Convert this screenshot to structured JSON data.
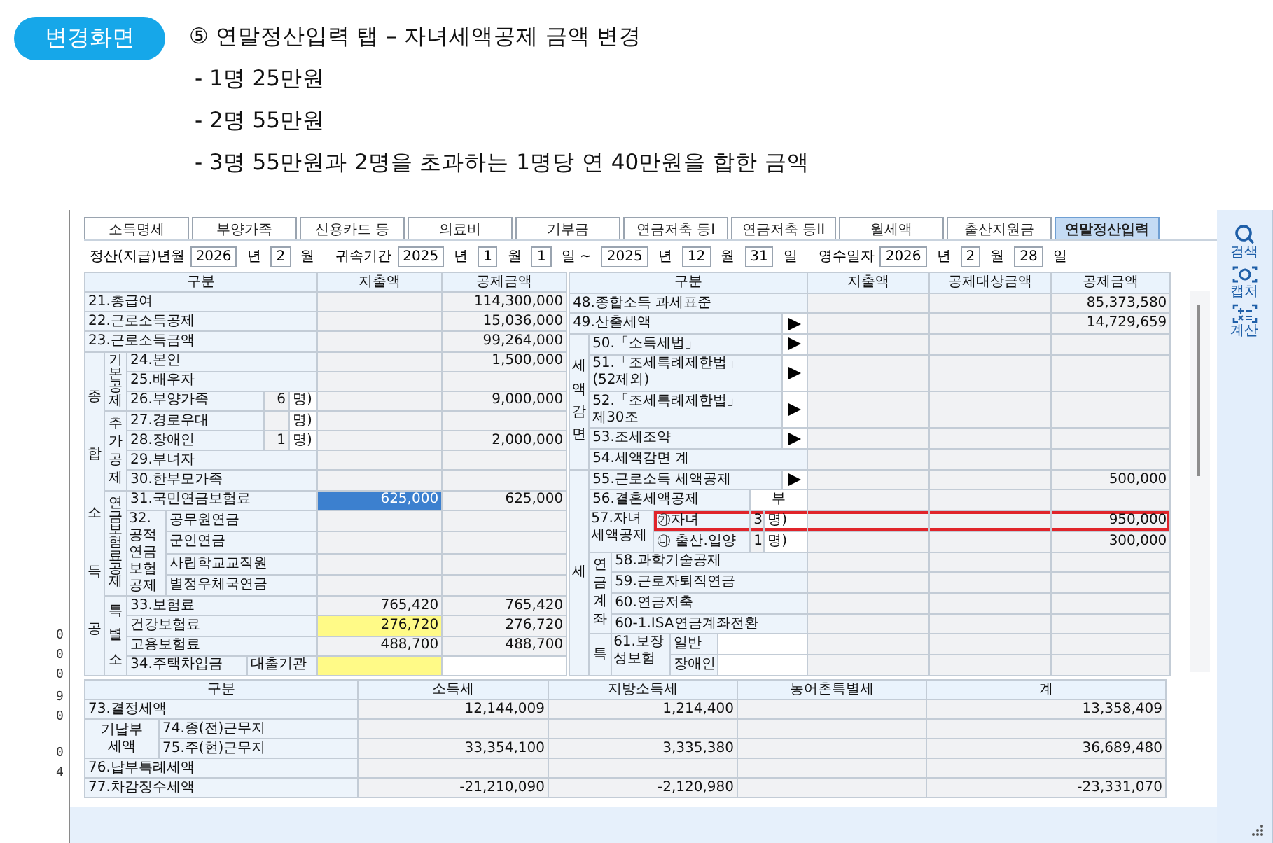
{
  "header": {
    "badge": "변경화면",
    "lines": [
      "⑤ 연말정산입력 탭 – 자녀세액공제 금액 변경",
      "- 1명 25만원",
      "- 2명 55만원",
      "- 3명 55만원과 2명을 초과하는 1명당 연 40만원을 합한 금액"
    ]
  },
  "background_digits": [
    [
      "0",
      "0",
      "0"
    ],
    [
      "9",
      "0",
      "0",
      "4"
    ]
  ],
  "tabs": [
    {
      "label": "소득명세",
      "selected": false
    },
    {
      "label": "부양가족",
      "selected": false
    },
    {
      "label": "신용카드 등",
      "selected": false
    },
    {
      "label": "의료비",
      "selected": false
    },
    {
      "label": "기부금",
      "selected": false
    },
    {
      "label": "연금저축 등I",
      "selected": false
    },
    {
      "label": "연금저축 등II",
      "selected": false
    },
    {
      "label": "월세액",
      "selected": false
    },
    {
      "label": "출산지원금",
      "selected": false
    },
    {
      "label": "연말정산입력",
      "selected": true
    }
  ],
  "date_row": [
    {
      "kind": "label",
      "text": "정산(지급)년월"
    },
    {
      "kind": "field",
      "text": "2026"
    },
    {
      "kind": "unit",
      "text": "년"
    },
    {
      "kind": "field",
      "text": "2"
    },
    {
      "kind": "unit",
      "text": "월"
    },
    {
      "kind": "label",
      "text": "귀속기간"
    },
    {
      "kind": "field",
      "text": "2025"
    },
    {
      "kind": "unit",
      "text": "년"
    },
    {
      "kind": "field",
      "text": "1"
    },
    {
      "kind": "unit",
      "text": "월"
    },
    {
      "kind": "field",
      "text": "1"
    },
    {
      "kind": "unit",
      "text": "일 ~"
    },
    {
      "kind": "field",
      "text": "2025"
    },
    {
      "kind": "unit",
      "text": "년"
    },
    {
      "kind": "field",
      "text": "12"
    },
    {
      "kind": "unit",
      "text": "월"
    },
    {
      "kind": "field",
      "text": "31"
    },
    {
      "kind": "unit",
      "text": "일"
    },
    {
      "kind": "label",
      "text": "영수일자"
    },
    {
      "kind": "field",
      "text": "2026"
    },
    {
      "kind": "unit",
      "text": "년"
    },
    {
      "kind": "field",
      "text": "2"
    },
    {
      "kind": "unit",
      "text": "월"
    },
    {
      "kind": "field",
      "text": "28"
    },
    {
      "kind": "unit",
      "text": "일"
    }
  ],
  "left_table": {
    "rows": [
      {
        "cells": [
          {
            "text": "구분",
            "kind": "head",
            "colspan": 7
          },
          {
            "text": "지출액",
            "kind": "head"
          },
          {
            "text": "공제금액",
            "kind": "head"
          }
        ]
      },
      {
        "cells": [
          {
            "text": "21.총급여",
            "kind": "label",
            "colspan": 7
          },
          {
            "kind": "value"
          },
          {
            "text": "114,300,000",
            "kind": "value"
          }
        ]
      },
      {
        "cells": [
          {
            "text": "22.근로소득공제",
            "kind": "label",
            "colspan": 7
          },
          {
            "kind": "value"
          },
          {
            "text": "15,036,000",
            "kind": "value"
          }
        ]
      },
      {
        "cells": [
          {
            "text": "23.근로소득금액",
            "kind": "label",
            "colspan": 7
          },
          {
            "kind": "value"
          },
          {
            "text": "99,264,000",
            "kind": "value"
          }
        ]
      },
      {
        "cells": [
          {
            "text": "종합소득공",
            "kind": "vlabel",
            "rowspan": 16
          },
          {
            "text": "기본공제",
            "kind": "vlabel",
            "rowspan": 3
          },
          {
            "text": "24.본인",
            "kind": "label",
            "colspan": 5
          },
          {
            "kind": "value"
          },
          {
            "text": "1,500,000",
            "kind": "value"
          }
        ]
      },
      {
        "cells": [
          {
            "text": "25.배우자",
            "kind": "label",
            "colspan": 5
          },
          {
            "kind": "value"
          },
          {
            "kind": "value"
          }
        ]
      },
      {
        "cells": [
          {
            "text": "26.부양가족",
            "kind": "label",
            "colspan": 3
          },
          {
            "text": "6",
            "kind": "count"
          },
          {
            "text": "명)",
            "kind": "unit"
          },
          {
            "kind": "value"
          },
          {
            "text": "9,000,000",
            "kind": "value"
          }
        ]
      },
      {
        "cells": [
          {
            "text": "추가공제",
            "kind": "vlabel",
            "rowspan": 4
          },
          {
            "text": "27.경로우대",
            "kind": "label",
            "colspan": 3
          },
          {
            "kind": "count"
          },
          {
            "text": "명)",
            "kind": "unit"
          },
          {
            "kind": "value"
          },
          {
            "kind": "value"
          }
        ]
      },
      {
        "cells": [
          {
            "text": "28.장애인",
            "kind": "label",
            "colspan": 3
          },
          {
            "text": "1",
            "kind": "count"
          },
          {
            "text": "명)",
            "kind": "unit"
          },
          {
            "kind": "value"
          },
          {
            "text": "2,000,000",
            "kind": "value"
          }
        ]
      },
      {
        "cells": [
          {
            "text": "29.부녀자",
            "kind": "label",
            "colspan": 5
          },
          {
            "kind": "value"
          },
          {
            "kind": "value"
          }
        ]
      },
      {
        "cells": [
          {
            "text": "30.한부모가족",
            "kind": "label",
            "colspan": 5
          },
          {
            "kind": "value"
          },
          {
            "kind": "value"
          }
        ]
      },
      {
        "cells": [
          {
            "text": "연금보험료공제",
            "kind": "vlabel",
            "rowspan": 5
          },
          {
            "text": "31.국민연금보험료",
            "kind": "label",
            "colspan": 5
          },
          {
            "text": "625,000",
            "kind": "selected"
          },
          {
            "text": "625,000",
            "kind": "value"
          }
        ]
      },
      {
        "cells": [
          {
            "text": "32. 공적연금보험공제",
            "kind": "wlabel",
            "rowspan": 4
          },
          {
            "text": "공무원연금",
            "kind": "label",
            "colspan": 4
          },
          {
            "kind": "value"
          },
          {
            "kind": "value"
          }
        ]
      },
      {
        "cells": [
          {
            "text": "군인연금",
            "kind": "label",
            "colspan": 4
          },
          {
            "kind": "value"
          },
          {
            "kind": "value"
          }
        ]
      },
      {
        "cells": [
          {
            "text": "사립학교교직원",
            "kind": "label",
            "colspan": 4
          },
          {
            "kind": "value"
          },
          {
            "kind": "value"
          }
        ]
      },
      {
        "cells": [
          {
            "text": "별정우체국연금",
            "kind": "label",
            "colspan": 4
          },
          {
            "kind": "value"
          },
          {
            "kind": "value"
          }
        ]
      },
      {
        "cells": [
          {
            "text": "특별소",
            "kind": "vlabel",
            "rowspan": 4
          },
          {
            "text": "33.보험료",
            "kind": "label",
            "colspan": 5
          },
          {
            "text": "765,420",
            "kind": "value"
          },
          {
            "text": "765,420",
            "kind": "value"
          }
        ]
      },
      {
        "cells": [
          {
            "text": "건강보험료",
            "kind": "label",
            "colspan": 5
          },
          {
            "text": "276,720",
            "kind": "required"
          },
          {
            "text": "276,720",
            "kind": "value"
          }
        ]
      },
      {
        "cells": [
          {
            "text": "고용보험료",
            "kind": "label",
            "colspan": 5
          },
          {
            "text": "488,700",
            "kind": "value"
          },
          {
            "text": "488,700",
            "kind": "value"
          }
        ]
      },
      {
        "cells": [
          {
            "text": "34.주택차입금",
            "kind": "label",
            "colspan": 2
          },
          {
            "text": "대출기관",
            "kind": "label",
            "colspan": 3
          },
          {
            "kind": "required"
          },
          {
            "kind": "input"
          }
        ]
      }
    ]
  },
  "right_table": {
    "rows": [
      {
        "cells": [
          {
            "text": "구분",
            "kind": "head",
            "colspan": 9
          },
          {
            "text": "지출액",
            "kind": "head"
          },
          {
            "text": "공제대상금액",
            "kind": "head"
          },
          {
            "text": "공제금액",
            "kind": "head"
          }
        ]
      },
      {
        "cells": [
          {
            "text": "48.종합소득 과세표준",
            "kind": "label",
            "colspan": 9
          },
          {
            "kind": "value"
          },
          {
            "kind": "value"
          },
          {
            "text": "85,373,580",
            "kind": "value"
          }
        ]
      },
      {
        "cells": [
          {
            "text": "49.산출세액",
            "kind": "label",
            "colspan": 8
          },
          {
            "kind": "arrow"
          },
          {
            "kind": "value"
          },
          {
            "kind": "value"
          },
          {
            "text": "14,729,659",
            "kind": "value"
          }
        ]
      },
      {
        "cells": [
          {
            "text": "세액감면",
            "kind": "vlabel",
            "rowspan": 5
          },
          {
            "text": "50.「소득세법」",
            "kind": "label",
            "colspan": 7
          },
          {
            "kind": "arrow"
          },
          {
            "kind": "value"
          },
          {
            "kind": "value"
          },
          {
            "kind": "value"
          }
        ]
      },
      {
        "cells": [
          {
            "text": "51.「조세특례제한법」\n(52제외)",
            "kind": "label",
            "colspan": 7
          },
          {
            "kind": "arrow"
          },
          {
            "kind": "value"
          },
          {
            "kind": "value"
          },
          {
            "kind": "value"
          }
        ]
      },
      {
        "cells": [
          {
            "text": "52.「조세특례제한법」\n제30조",
            "kind": "label",
            "colspan": 7
          },
          {
            "kind": "arrow"
          },
          {
            "kind": "value"
          },
          {
            "kind": "value"
          },
          {
            "kind": "value"
          }
        ]
      },
      {
        "cells": [
          {
            "text": "53.조세조약",
            "kind": "label",
            "colspan": 7
          },
          {
            "kind": "arrow"
          },
          {
            "kind": "value"
          },
          {
            "kind": "value"
          },
          {
            "kind": "value"
          }
        ]
      },
      {
        "cells": [
          {
            "text": "54.세액감면 계",
            "kind": "label",
            "colspan": 8
          },
          {
            "kind": "value"
          },
          {
            "kind": "value"
          },
          {
            "kind": "value"
          }
        ]
      },
      {
        "cells": [
          {
            "text": "세",
            "kind": "vlabel",
            "rowspan": 10
          },
          {
            "text": "55.근로소득 세액공제",
            "kind": "label",
            "colspan": 7
          },
          {
            "kind": "arrow"
          },
          {
            "kind": "value"
          },
          {
            "kind": "value"
          },
          {
            "text": "500,000",
            "kind": "value"
          }
        ]
      },
      {
        "cells": [
          {
            "text": "56.결혼세액공제",
            "kind": "label",
            "colspan": 5
          },
          {
            "text": "부",
            "kind": "choice",
            "colspan": 3
          },
          {
            "kind": "value"
          },
          {
            "kind": "value"
          },
          {
            "kind": "value"
          }
        ]
      },
      {
        "highlighted": true,
        "cells": [
          {
            "text": "57.자녀 세액공제",
            "kind": "wlabel",
            "colspan": 2,
            "rowspan": 2
          },
          {
            "text": "㉮자녀",
            "kind": "label",
            "colspan": 3
          },
          {
            "text": "3",
            "kind": "count"
          },
          {
            "text": "명)",
            "kind": "unit",
            "colspan": 2
          },
          {
            "kind": "value"
          },
          {
            "kind": "value"
          },
          {
            "text": "950,000",
            "kind": "value"
          }
        ]
      },
      {
        "highlighted": false,
        "cells": [
          {
            "text": "㉯ 출산.입양",
            "kind": "label",
            "colspan": 3
          },
          {
            "text": "1",
            "kind": "count"
          },
          {
            "text": "명)",
            "kind": "unit",
            "colspan": 2
          },
          {
            "kind": "value"
          },
          {
            "kind": "value"
          },
          {
            "text": "300,000",
            "kind": "value"
          }
        ]
      },
      {
        "cells": [
          {
            "text": "연금계좌",
            "kind": "vlabel",
            "rowspan": 4
          },
          {
            "text": "58.과학기술공제",
            "kind": "label",
            "colspan": 7
          },
          {
            "kind": "value"
          },
          {
            "kind": "value"
          },
          {
            "kind": "value"
          }
        ]
      },
      {
        "cells": [
          {
            "text": "59.근로자퇴직연금",
            "kind": "label",
            "colspan": 7
          },
          {
            "kind": "value"
          },
          {
            "kind": "value"
          },
          {
            "kind": "value"
          }
        ]
      },
      {
        "cells": [
          {
            "text": "60.연금저축",
            "kind": "label",
            "colspan": 7
          },
          {
            "kind": "value"
          },
          {
            "kind": "value"
          },
          {
            "kind": "value"
          }
        ]
      },
      {
        "cells": [
          {
            "text": "60-1.ISA연금계좌전환",
            "kind": "label",
            "colspan": 7
          },
          {
            "kind": "value"
          },
          {
            "kind": "value"
          },
          {
            "kind": "value"
          }
        ]
      },
      {
        "cells": [
          {
            "text": "특",
            "kind": "vlabel",
            "rowspan": 2
          },
          {
            "text": "61.보장성보험",
            "kind": "wlabel",
            "colspan": 2,
            "rowspan": 2
          },
          {
            "text": "일반",
            "kind": "label"
          },
          {
            "kind": "input",
            "colspan": 4
          },
          {
            "kind": "value"
          },
          {
            "kind": "value"
          },
          {
            "kind": "value"
          }
        ]
      },
      {
        "cells": [
          {
            "text": "장애인",
            "kind": "label"
          },
          {
            "kind": "input",
            "colspan": 4
          },
          {
            "kind": "value"
          },
          {
            "kind": "value"
          },
          {
            "kind": "value"
          }
        ]
      }
    ]
  },
  "bottom_table": {
    "rows": [
      {
        "cells": [
          {
            "text": "구분",
            "kind": "head",
            "colspan": 2
          },
          {
            "text": "소득세",
            "kind": "head"
          },
          {
            "text": "지방소득세",
            "kind": "head"
          },
          {
            "text": "농어촌특별세",
            "kind": "head"
          },
          {
            "text": "계",
            "kind": "head"
          }
        ]
      },
      {
        "cells": [
          {
            "text": "73.결정세액",
            "kind": "label",
            "colspan": 2
          },
          {
            "text": "12,144,009",
            "kind": "value"
          },
          {
            "text": "1,214,400",
            "kind": "value"
          },
          {
            "kind": "value"
          },
          {
            "text": "13,358,409",
            "kind": "value"
          }
        ]
      },
      {
        "cells": [
          {
            "text": "기납부\n세액",
            "kind": "clabel",
            "rowspan": 2
          },
          {
            "text": "74.종(전)근무지",
            "kind": "label"
          },
          {
            "kind": "value"
          },
          {
            "kind": "value"
          },
          {
            "kind": "value"
          },
          {
            "kind": "value"
          }
        ]
      },
      {
        "cells": [
          {
            "text": "75.주(현)근무지",
            "kind": "label"
          },
          {
            "text": "33,354,100",
            "kind": "value"
          },
          {
            "text": "3,335,380",
            "kind": "value"
          },
          {
            "kind": "value"
          },
          {
            "text": "36,689,480",
            "kind": "value"
          }
        ]
      },
      {
        "cells": [
          {
            "text": "76.납부특례세액",
            "kind": "label",
            "colspan": 2
          },
          {
            "kind": "value"
          },
          {
            "kind": "value"
          },
          {
            "kind": "value"
          },
          {
            "kind": "value"
          }
        ]
      },
      {
        "cells": [
          {
            "text": "77.차감징수세액",
            "kind": "label",
            "colspan": 2
          },
          {
            "text": "-21,210,090",
            "kind": "value"
          },
          {
            "text": "-2,120,980",
            "kind": "value"
          },
          {
            "kind": "value"
          },
          {
            "text": "-23,331,070",
            "kind": "value"
          }
        ]
      }
    ]
  },
  "sidebar": [
    {
      "kind": "search",
      "label": "검색"
    },
    {
      "kind": "capture",
      "label": "캡처"
    },
    {
      "kind": "calculator",
      "label": "계산"
    }
  ]
}
